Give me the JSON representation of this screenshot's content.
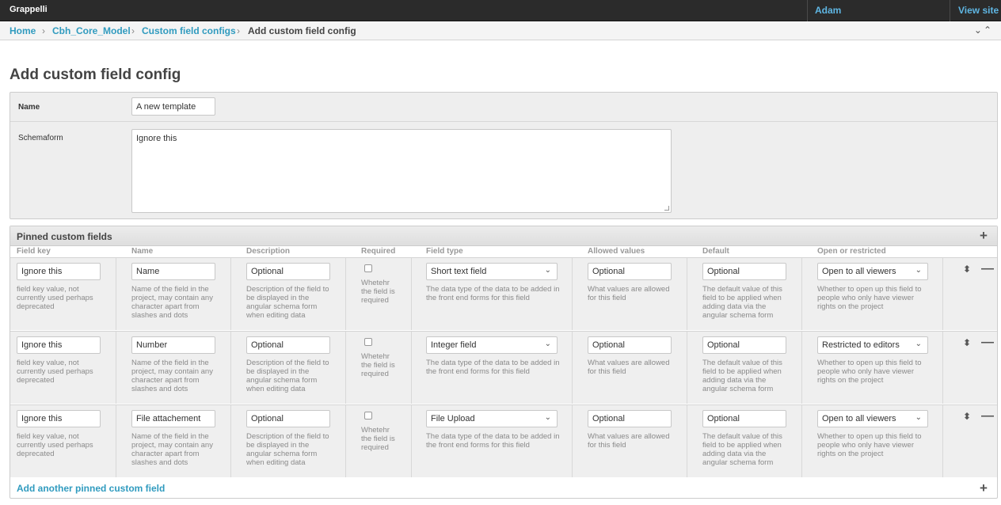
{
  "header": {
    "brand": "Grappelli",
    "user": "Adam",
    "view_site": "View site"
  },
  "breadcrumb": {
    "home": "Home",
    "model": "Cbh_Core_Model",
    "list": "Custom field configs",
    "current": "Add custom field config",
    "sep": "›",
    "tools": "⌄⌃"
  },
  "page": {
    "title": "Add custom field config"
  },
  "form": {
    "name_label": "Name",
    "name_value": "A new template",
    "schemaform_label": "Schemaform",
    "schemaform_value": "Ignore this"
  },
  "inline": {
    "title": "Pinned custom fields",
    "add_icon": "plus-icon",
    "columns": [
      "Field key",
      "Name",
      "Description",
      "Required",
      "Field type",
      "Allowed values",
      "Default",
      "Open or restricted"
    ],
    "help": {
      "field_key": "field key value, not currently used perhaps deprecated",
      "name": "Name of the field in the project, may contain any character apart from slashes and dots",
      "description": "Description of the field to be displayed in the angular schema form when editing data",
      "required": "Whetehr the field is required",
      "field_type": "The data type of the data to be added in the front end forms for this field",
      "allowed_values": "What values are allowed for this field",
      "default": "The default value of this field to be applied when adding data via the angular schema form",
      "open": "Whether to open up this field to people who only have viewer rights on the project"
    },
    "rows": [
      {
        "field_key": "Ignore this",
        "name": "Name",
        "description": "Optional",
        "field_type": "Short text field",
        "allowed": "Optional",
        "default": "Optional",
        "open": "Open to all viewers"
      },
      {
        "field_key": "Ignore this",
        "name": "Number",
        "description": "Optional",
        "field_type": "Integer field",
        "allowed": "Optional",
        "default": "Optional",
        "open": "Restricted to editors"
      },
      {
        "field_key": "Ignore this",
        "name": "File attachement",
        "description": "Optional",
        "field_type": "File Upload",
        "allowed": "Optional",
        "default": "Optional",
        "open": "Open to all viewers"
      }
    ],
    "add_another": "Add another pinned custom field"
  }
}
